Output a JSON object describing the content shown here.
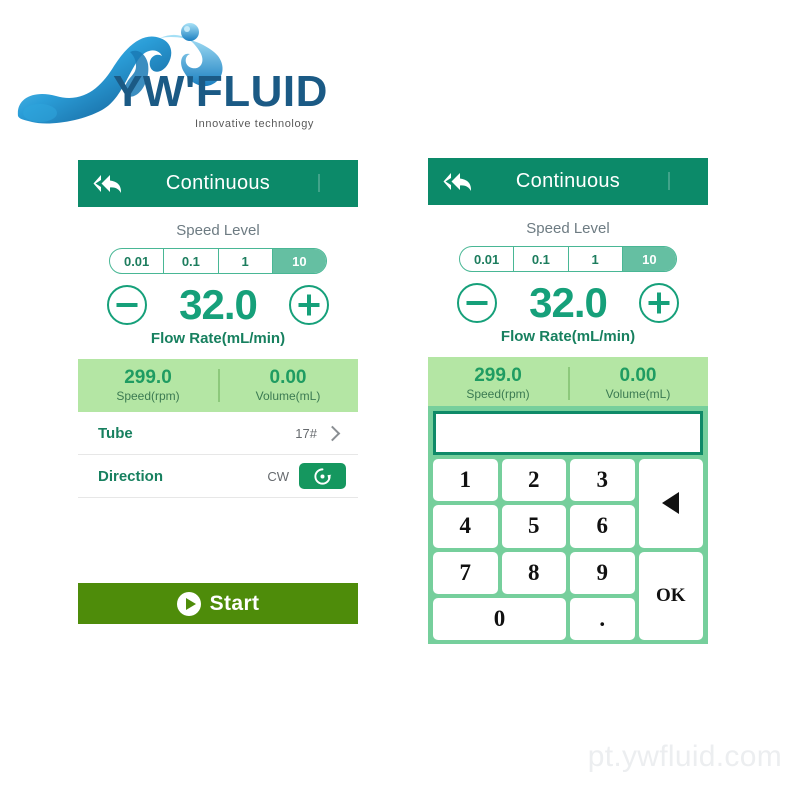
{
  "brand": {
    "name": "YW'FLUID",
    "tagline": "Innovative  technology",
    "logo_icon": "water-splash-icon",
    "colors": {
      "logo_text": "#1b5a85",
      "logo_wave": "#1b7fc0"
    }
  },
  "watermark": "pt.ywfluid.com",
  "colors": {
    "header_green": "#0c8a69",
    "accent_teal": "#16a07a",
    "info_bar_green": "#b4e6a4",
    "start_olive": "#4e8c0a",
    "keypad_green": "#76cf9c",
    "segment_active": "#65bfa2"
  },
  "panel_left": {
    "header": {
      "title": "Continuous",
      "back_icon": "back-double-arrow-icon"
    },
    "speed_level": {
      "label": "Speed Level",
      "options": [
        "0.01",
        "0.1",
        "1",
        "10"
      ],
      "selected": "10"
    },
    "flow": {
      "minus_icon": "minus-circle-icon",
      "plus_icon": "plus-circle-icon",
      "value": "32.0",
      "caption": "Flow Rate(mL/min)"
    },
    "info": {
      "speed_value": "299.0",
      "speed_caption": "Speed(rpm)",
      "volume_value": "0.00",
      "volume_caption": "Volume(mL)"
    },
    "rows": [
      {
        "label": "Tube",
        "value": "17#",
        "chevron_icon": "chevron-right-icon"
      },
      {
        "label": "Direction",
        "value": "CW",
        "button_icon": "rotate-clockwise-icon"
      }
    ],
    "start": {
      "label": "Start",
      "icon": "play-circle-icon"
    }
  },
  "panel_right": {
    "header": {
      "title": "Continuous",
      "back_icon": "back-double-arrow-icon"
    },
    "speed_level": {
      "label": "Speed Level",
      "options": [
        "0.01",
        "0.1",
        "1",
        "10"
      ],
      "selected": "10"
    },
    "flow": {
      "minus_icon": "minus-circle-icon",
      "plus_icon": "plus-circle-icon",
      "value": "32.0",
      "caption": "Flow Rate(mL/min)"
    },
    "info": {
      "speed_value": "299.0",
      "speed_caption": "Speed(rpm)",
      "volume_value": "0.00",
      "volume_caption": "Volume(mL)"
    },
    "keypad": {
      "display_value": "",
      "keys": [
        "1",
        "2",
        "3",
        "4",
        "5",
        "6",
        "7",
        "8",
        "9",
        "0",
        "."
      ],
      "backspace_icon": "backspace-left-arrow-icon",
      "ok_label": "OK"
    }
  }
}
